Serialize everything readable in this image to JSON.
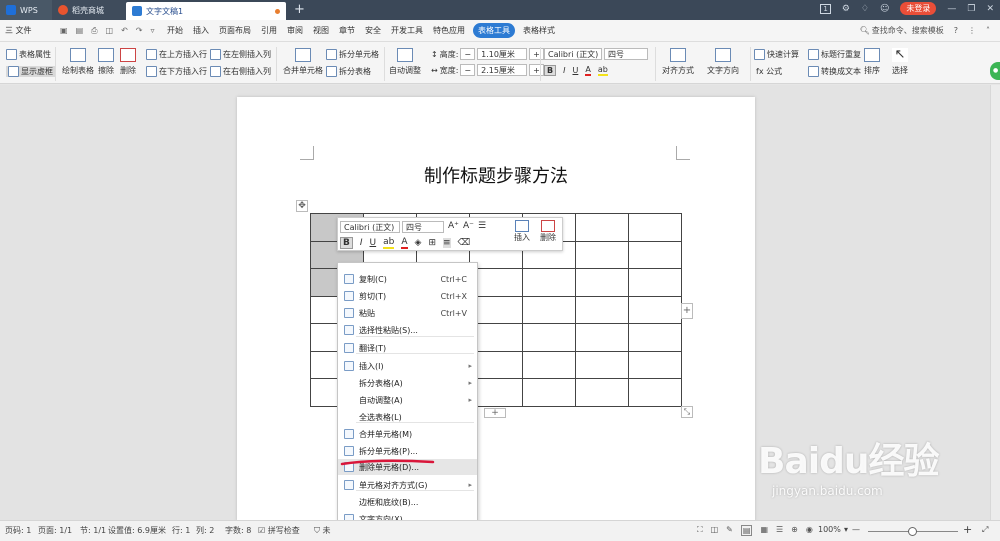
{
  "titlebar": {
    "tabs": [
      {
        "label": "WPS",
        "icon": "wps-logo-icon"
      },
      {
        "label": "稻壳商城",
        "icon": "daoke-icon"
      },
      {
        "label": "文字文稿1",
        "icon": "writer-doc-icon"
      }
    ],
    "login_label": "未登录",
    "page_counter": "1"
  },
  "menubar": {
    "file_label": "三 文件",
    "items": [
      "开始",
      "插入",
      "页面布局",
      "引用",
      "审阅",
      "视图",
      "章节",
      "安全",
      "开发工具",
      "特色应用",
      "表格工具",
      "表格样式"
    ],
    "active": "表格工具",
    "search_label": "查找命令、搜索模板"
  },
  "ribbon": {
    "table_props": "表格属性",
    "show_gridlines": "显示虚框",
    "draw_table": "绘制表格",
    "erase": "擦除",
    "delete": "删除",
    "summary": "汇总",
    "insert_above": "在上方插入行",
    "insert_below": "在下方插入行",
    "insert_left": "在左侧插入列",
    "insert_right": "在右侧插入列",
    "merge_cells": "合并单元格",
    "split_cells": "拆分单元格",
    "split_table": "拆分表格",
    "auto_fit": "自动调整",
    "height_label": "高度:",
    "height_value": "1.10厘米",
    "width_label": "宽度:",
    "width_value": "2.15厘米",
    "font_name": "Calibri (正文)",
    "font_size": "四号",
    "align": "对齐方式",
    "text_dir": "文字方向",
    "quick_calc": "快速计算",
    "formula": "fx 公式",
    "title_repeat": "标题行重复",
    "to_text": "转换成文本",
    "sort": "排序",
    "select": "选择"
  },
  "document": {
    "title": "制作标题步骤方法",
    "table_rows": 7,
    "table_cols": 7
  },
  "mini_toolbar": {
    "font_name": "Calibri (正文)",
    "font_size": "四号",
    "insert": "插入",
    "delete": "删除"
  },
  "context_menu": [
    {
      "label": "复制(C)",
      "shortcut": "Ctrl+C",
      "icon": "copy-icon"
    },
    {
      "label": "剪切(T)",
      "shortcut": "Ctrl+X",
      "icon": "cut-icon"
    },
    {
      "label": "粘贴",
      "shortcut": "Ctrl+V",
      "icon": "paste-icon"
    },
    {
      "label": "选择性粘贴(S)...",
      "shortcut": "",
      "icon": "paste-special-icon"
    },
    {
      "label": "翻译(T)",
      "shortcut": "",
      "icon": "translate-icon"
    },
    {
      "label": "插入(I)",
      "shortcut": "",
      "icon": "insert-icon",
      "submenu": true
    },
    {
      "label": "拆分表格(A)",
      "shortcut": "",
      "icon": "",
      "submenu": true
    },
    {
      "label": "自动调整(A)",
      "shortcut": "",
      "icon": "",
      "submenu": true
    },
    {
      "label": "全选表格(L)",
      "shortcut": "",
      "icon": ""
    },
    {
      "label": "合并单元格(M)",
      "shortcut": "",
      "icon": "merge-cells-icon"
    },
    {
      "label": "拆分单元格(P)...",
      "shortcut": "",
      "icon": "split-cells-icon"
    },
    {
      "label": "删除单元格(D)...",
      "shortcut": "",
      "icon": "delete-cells-icon",
      "highlighted": true
    },
    {
      "label": "单元格对齐方式(G)",
      "shortcut": "",
      "icon": "cell-align-icon",
      "submenu": true
    },
    {
      "label": "边框和底纹(B)...",
      "shortcut": "",
      "icon": ""
    },
    {
      "label": "文字方向(X)...",
      "shortcut": "",
      "icon": "text-direction-icon"
    }
  ],
  "statusbar": {
    "page_num": "页码: 1",
    "pages": "页面: 1/1",
    "section": "节: 1/1",
    "setting": "设置值: 6.9厘米",
    "row": "行: 1",
    "col": "列: 2",
    "word_count": "字数: 8",
    "spell_check": "拼写检查",
    "doc_status": "未",
    "zoom": "100%"
  },
  "watermark": {
    "logo": "Baidu经验",
    "url": "jingyan.baidu.com"
  },
  "colors": {
    "titlebar": "#3b4858",
    "accent": "#2d7bd3",
    "login": "#e94e38",
    "annotation": "#d9163a",
    "selected_cell": "#c8c8c8"
  }
}
